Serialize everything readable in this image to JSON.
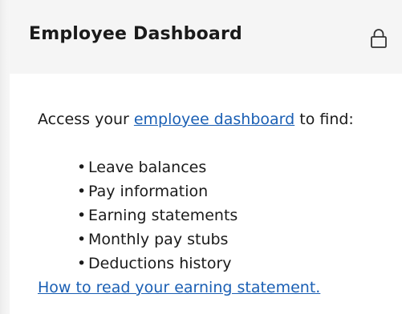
{
  "card": {
    "title": "Employee Dashboard",
    "header_icon": "lock-icon",
    "intro_text_before": "Access your ",
    "intro_link": "employee dashboard",
    "intro_text_after": " to find:",
    "bullet_glyph": "•",
    "items": [
      "Leave balances",
      "Pay information",
      "Earning statements",
      "Monthly pay stubs",
      "Deductions history"
    ],
    "howto_link": "How to read your earning statement."
  },
  "colors": {
    "header_bg": "#f5f5f5",
    "link": "#1a5fb4",
    "text": "#1a1a1a"
  }
}
